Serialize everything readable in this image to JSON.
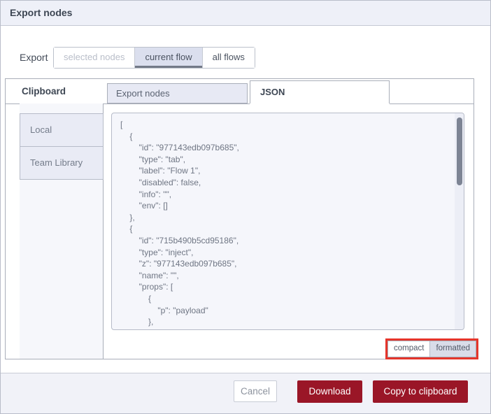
{
  "header": {
    "title": "Export nodes"
  },
  "export_row": {
    "label": "Export",
    "options": [
      {
        "label": "selected nodes",
        "state": "disabled"
      },
      {
        "label": "current flow",
        "state": "selected"
      },
      {
        "label": "all flows",
        "state": "normal"
      }
    ]
  },
  "panel": {
    "section_label": "Clipboard",
    "tabs": [
      {
        "label": "Export nodes",
        "active": false
      },
      {
        "label": "JSON",
        "active": true
      }
    ],
    "sidebar_items": [
      {
        "label": "Local"
      },
      {
        "label": "Team Library"
      }
    ],
    "editor": {
      "json_lines": [
        "[",
        "    {",
        "        \"id\": \"977143edb097b685\",",
        "        \"type\": \"tab\",",
        "        \"label\": \"Flow 1\",",
        "        \"disabled\": false,",
        "        \"info\": \"\",",
        "        \"env\": []",
        "    },",
        "    {",
        "        \"id\": \"715b490b5cd95186\",",
        "        \"type\": \"inject\",",
        "        \"z\": \"977143edb097b685\",",
        "        \"name\": \"\",",
        "        \"props\": [",
        "            {",
        "                \"p\": \"payload\"",
        "            },"
      ],
      "format_options": [
        {
          "label": "compact",
          "selected": false
        },
        {
          "label": "formatted",
          "selected": true
        }
      ]
    }
  },
  "footer": {
    "cancel_label": "Cancel",
    "download_label": "Download",
    "copy_label": "Copy to clipboard"
  },
  "colors": {
    "accent": "#9a1627",
    "annotation": "#e5352b",
    "selected-bg": "#dbdfee",
    "tab-bg": "#e7e9f4",
    "header-bg": "#eef0f8",
    "panel-border": "#a9aeb9",
    "editor-bg": "#f5f6fb"
  }
}
